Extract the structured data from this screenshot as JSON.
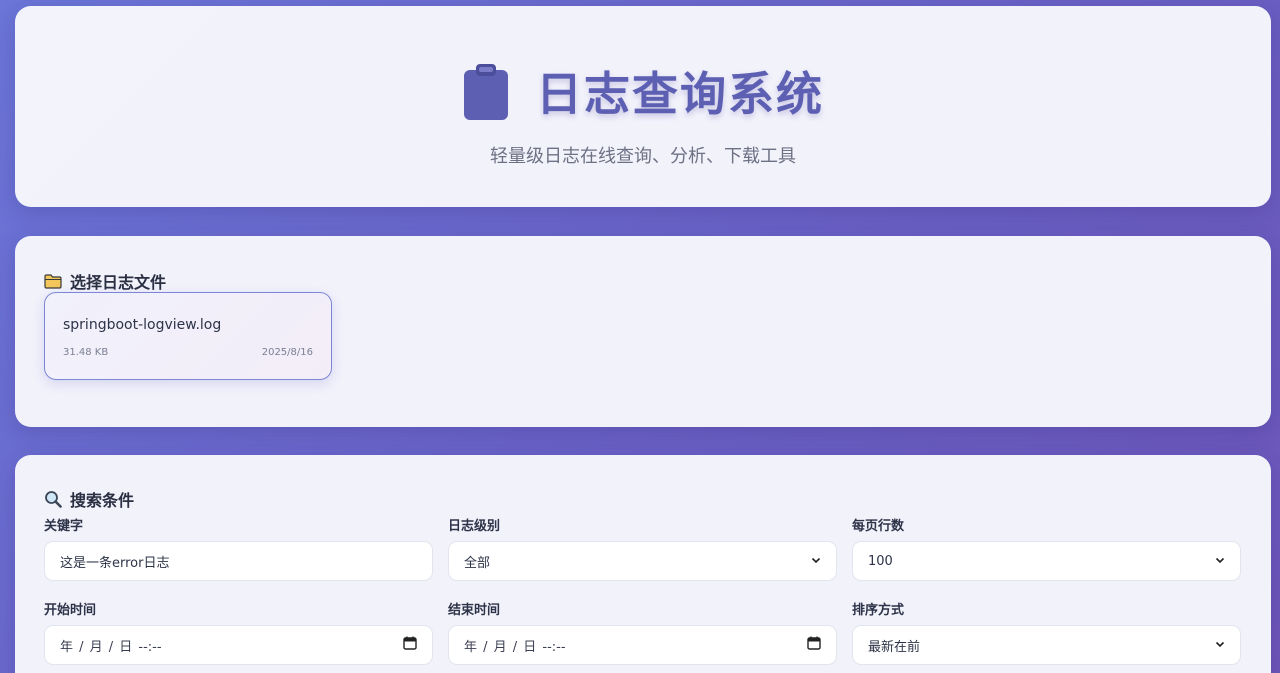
{
  "header": {
    "icon": "clipboard-icon",
    "title": "日志查询系统",
    "subtitle": "轻量级日志在线查询、分析、下载工具"
  },
  "file_section": {
    "icon": "folder-icon",
    "title": "选择日志文件",
    "files": [
      {
        "name": "springboot-logview.log",
        "size": "31.48 KB",
        "date": "2025/8/16",
        "selected": true
      }
    ]
  },
  "search_section": {
    "icon": "search-icon",
    "title": "搜索条件",
    "keyword": {
      "label": "关键字",
      "value": "这是一条error日志"
    },
    "level": {
      "label": "日志级别",
      "value": "全部"
    },
    "page_size": {
      "label": "每页行数",
      "value": "100"
    },
    "start_time": {
      "label": "开始时间",
      "placeholder": "年 / 月 / 日 --:--"
    },
    "end_time": {
      "label": "结束时间",
      "placeholder": "年 / 月 / 日 --:--"
    },
    "sort": {
      "label": "排序方式",
      "value": "最新在前"
    }
  },
  "colors": {
    "accent": "#5d5fb3",
    "background_start": "#6b76d8",
    "background_end": "#6d56b8",
    "card": "#f7f7fc",
    "selected_border": "#7c86d8"
  }
}
